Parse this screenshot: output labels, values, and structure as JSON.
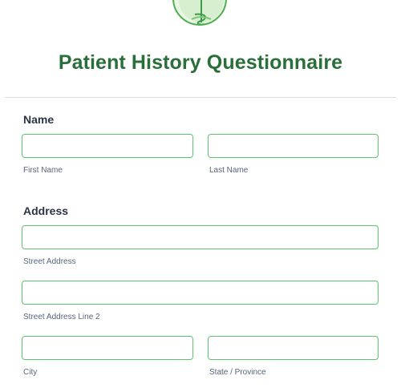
{
  "form": {
    "title": "Patient History Questionnaire",
    "name_section": {
      "label": "Name",
      "first_name": {
        "value": "",
        "sublabel": "First Name"
      },
      "last_name": {
        "value": "",
        "sublabel": "Last Name"
      }
    },
    "address_section": {
      "label": "Address",
      "street": {
        "value": "",
        "sublabel": "Street Address"
      },
      "street2": {
        "value": "",
        "sublabel": "Street Address Line 2"
      },
      "city": {
        "value": "",
        "sublabel": "City"
      },
      "state": {
        "value": "",
        "sublabel": "State / Province"
      }
    }
  },
  "colors": {
    "title": "#2a6e3a",
    "field_border": "#5cc66b",
    "logo_fill": "#eaf6e4"
  },
  "logo": {
    "icon": "caduceus-snake-icon"
  }
}
